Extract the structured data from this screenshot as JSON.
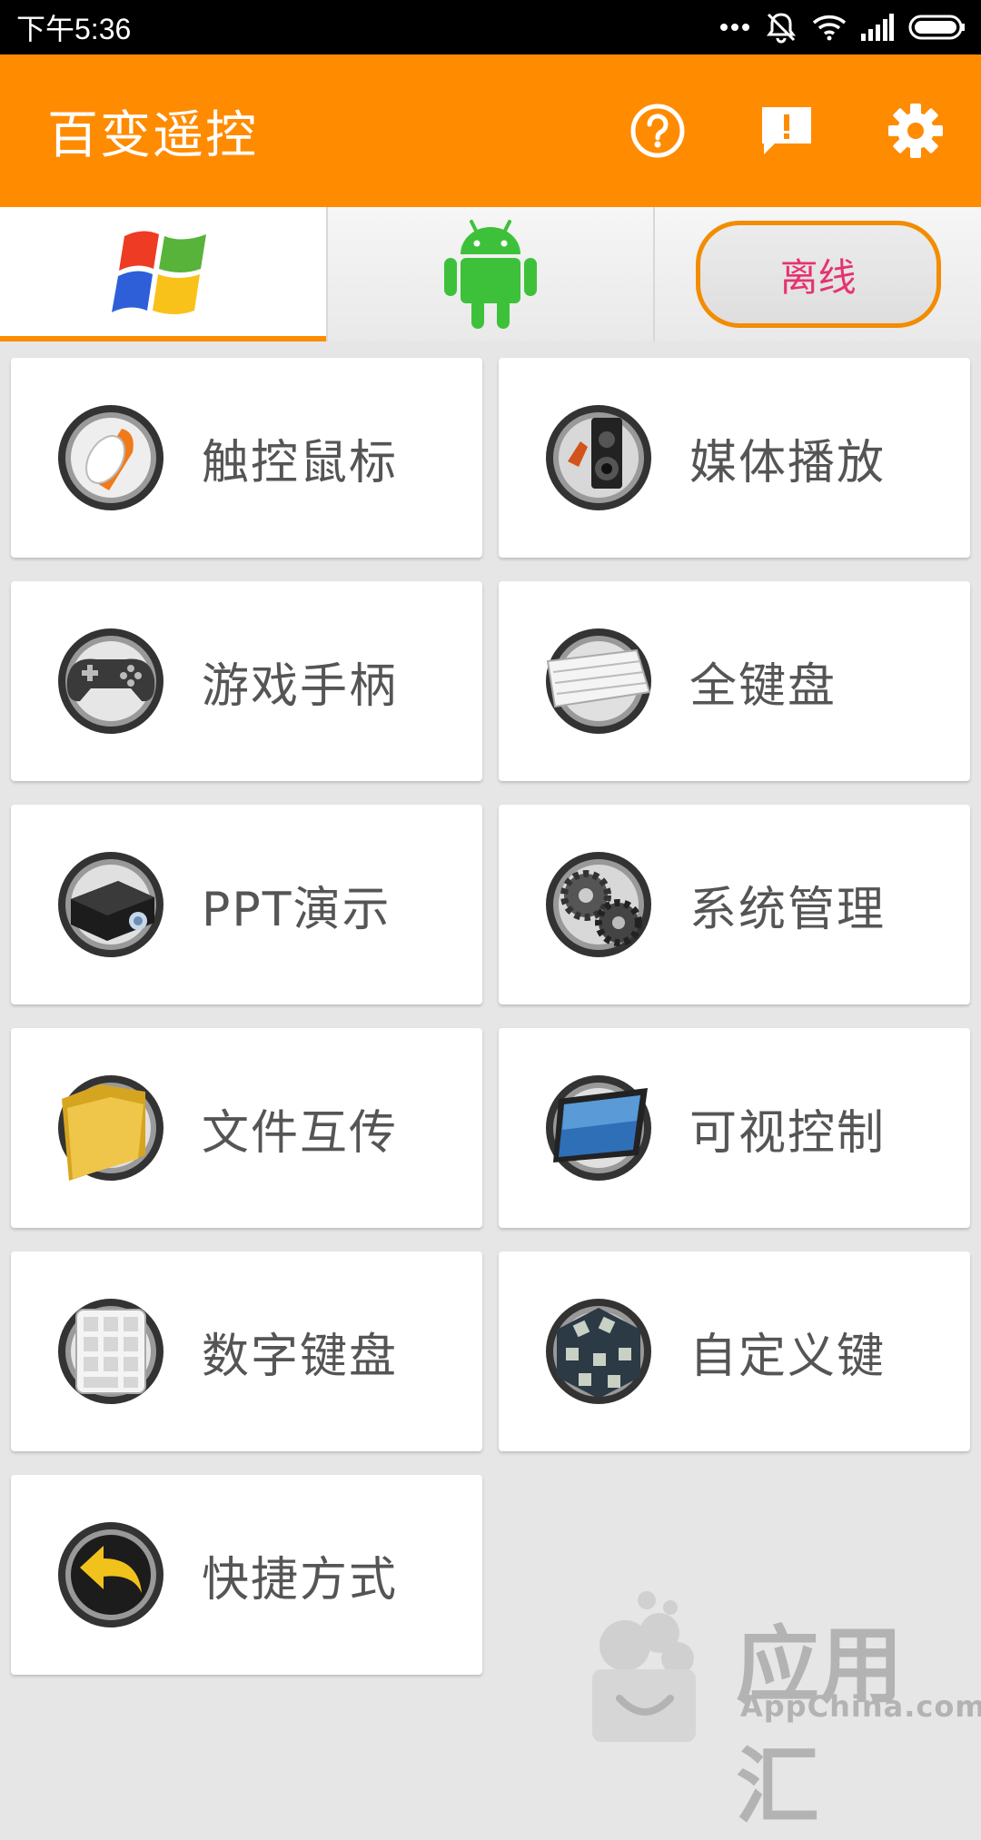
{
  "status": {
    "time": "下午5:36"
  },
  "app": {
    "title": "百变遥控"
  },
  "tabs": {
    "offline_label": "离线"
  },
  "grid": [
    {
      "label": "触控鼠标",
      "icon": "mouse-icon"
    },
    {
      "label": "媒体播放",
      "icon": "media-player-icon"
    },
    {
      "label": "游戏手柄",
      "icon": "gamepad-icon"
    },
    {
      "label": "全键盘",
      "icon": "keyboard-icon"
    },
    {
      "label": "PPT演示",
      "icon": "projector-icon"
    },
    {
      "label": "系统管理",
      "icon": "gears-icon"
    },
    {
      "label": "文件互传",
      "icon": "folder-icon"
    },
    {
      "label": "可视控制",
      "icon": "screen-icon"
    },
    {
      "label": "数字键盘",
      "icon": "numpad-icon"
    },
    {
      "label": "自定义键",
      "icon": "cube-icon"
    },
    {
      "label": "快捷方式",
      "icon": "shortcut-arrow-icon"
    }
  ],
  "watermark": {
    "brand": "应用汇",
    "site": "AppChina.com"
  },
  "colors": {
    "accent": "#ff8b00",
    "offline_text": "#e6336f"
  }
}
